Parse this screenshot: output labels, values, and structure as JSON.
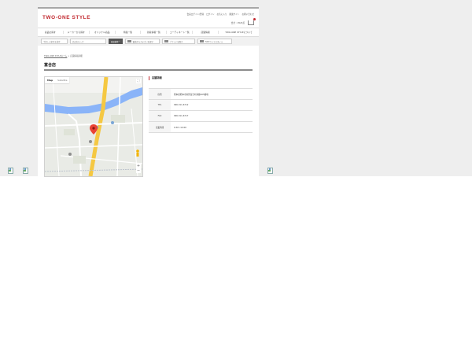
{
  "brand": {
    "logo_text": "TWO-ONE STYLE",
    "accent_color": "#c1272d"
  },
  "top_links": [
    "会員ログイン/登録",
    "ログイン",
    "お気に入り",
    "関連サイト",
    "お問い合わせ"
  ],
  "cart": {
    "label": "合計 : ¥0/0点"
  },
  "global_nav": [
    "商品を探す",
    "メーカーから探す",
    "オリジナル商品",
    "特集一覧",
    "新着情報一覧",
    "コーディネート一覧",
    "店舗情報",
    "TWO-ONE STYLEについて"
  ],
  "search": {
    "keyword_placeholder": "今探しの家具を検索",
    "keyword2_placeholder": "商品名を入力",
    "button_label": "商品検索",
    "select1": "価格からカテゴリを探す",
    "select2": "ブランドを探す",
    "select3": "TWOライフスタイル"
  },
  "breadcrumb": {
    "home": "TWO-ONE STYLEホーム",
    "separator": ">",
    "current": "店舗情報詳細"
  },
  "page_title": "富合店",
  "map": {
    "tab_map": "Map",
    "tab_satellite": "Satellite",
    "fullscreen_icon": "fullscreen-icon",
    "zoom_in": "+",
    "zoom_out": "−"
  },
  "store_info": {
    "heading": "店舗詳細",
    "rows": [
      {
        "key": "住所",
        "value": "熊本県熊本市南区富合町清藤405番地"
      },
      {
        "key": "TEL",
        "value": "096-311-6712"
      },
      {
        "key": "FAX",
        "value": "096-311-6717"
      },
      {
        "key": "営業時間",
        "value": "9:30～19:00"
      }
    ]
  }
}
